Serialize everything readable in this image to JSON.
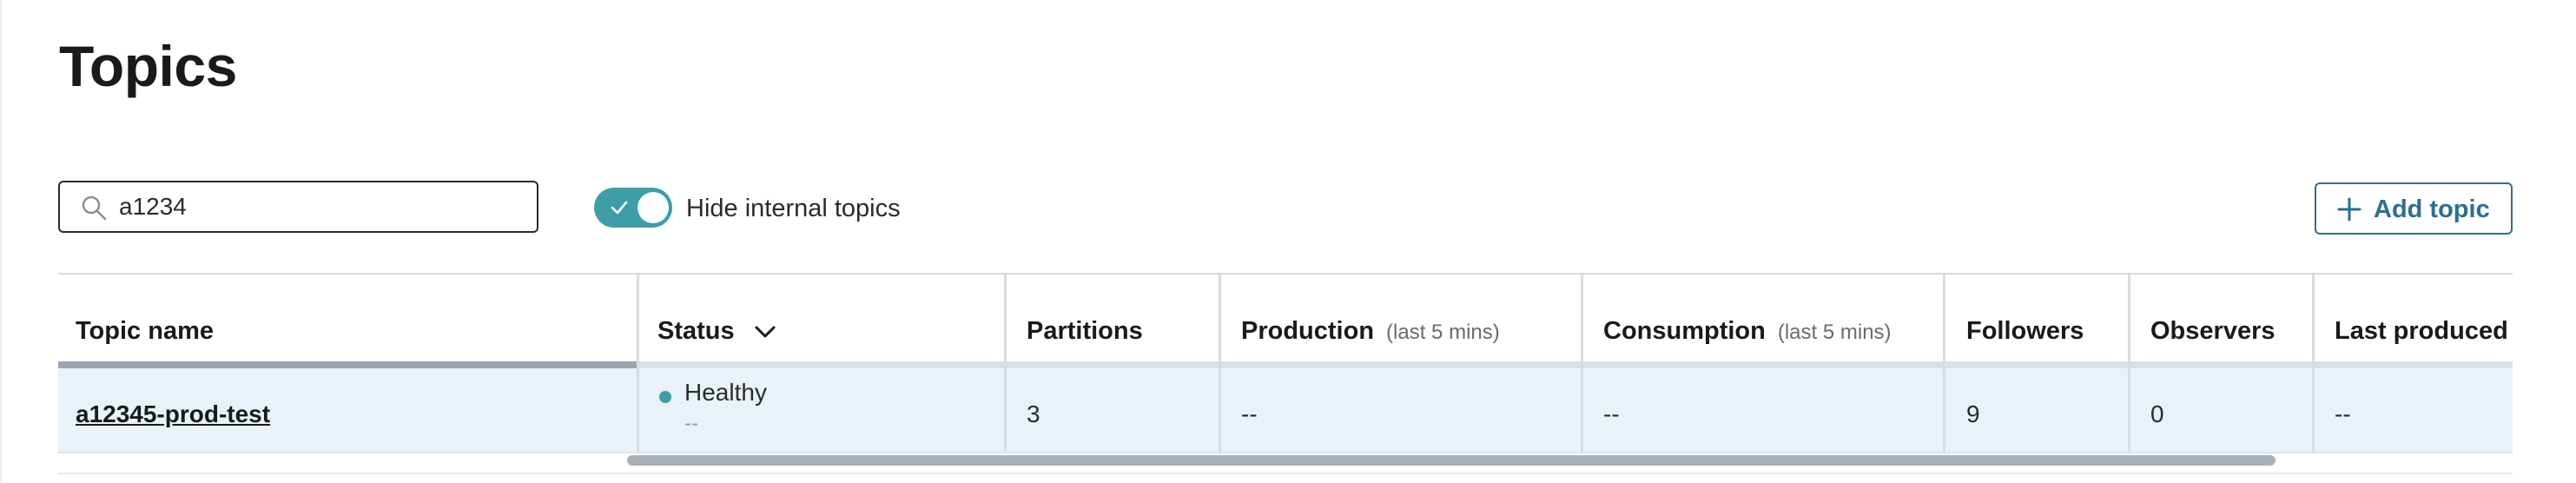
{
  "page": {
    "title": "Topics"
  },
  "toolbar": {
    "search": {
      "value": "a1234",
      "placeholder": "Search topics",
      "icon": "search-icon"
    },
    "toggle": {
      "label": "Hide internal topics",
      "checked": true,
      "accent": "#3d9ea8"
    },
    "add_topic": {
      "label": "Add topic",
      "icon": "plus-icon",
      "color": "#2b6f8f"
    }
  },
  "table": {
    "columns": [
      {
        "label": "Topic name",
        "sub": ""
      },
      {
        "label": "Status",
        "sub": ""
      },
      {
        "label": "Partitions",
        "sub": ""
      },
      {
        "label": "Production",
        "sub": "(last 5 mins)"
      },
      {
        "label": "Consumption",
        "sub": "(last 5 mins)"
      },
      {
        "label": "Followers",
        "sub": ""
      },
      {
        "label": "Observers",
        "sub": ""
      },
      {
        "label": "Last produced",
        "sub": ""
      }
    ],
    "rows": [
      {
        "topic": "a12345-prod-test",
        "status": "Healthy",
        "status_sub": "--",
        "partitions": "3",
        "production": "--",
        "consumption": "--",
        "followers": "9",
        "observers": "0",
        "last_produced": "--"
      }
    ]
  }
}
